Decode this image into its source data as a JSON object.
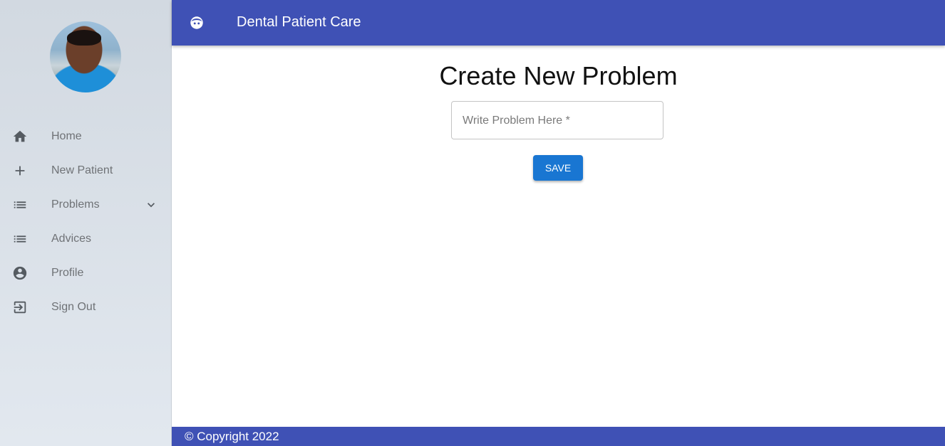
{
  "app": {
    "title": "Dental Patient Care",
    "logo_icon": "tooth-face-icon"
  },
  "sidebar": {
    "avatar_icon": "user-photo",
    "items": [
      {
        "label": "Home",
        "icon": "home-icon"
      },
      {
        "label": "New Patient",
        "icon": "plus-icon"
      },
      {
        "label": "Problems",
        "icon": "list-icon",
        "expandable": true
      },
      {
        "label": "Advices",
        "icon": "list-icon"
      },
      {
        "label": "Profile",
        "icon": "account-circle-icon"
      },
      {
        "label": "Sign Out",
        "icon": "exit-icon"
      }
    ]
  },
  "main": {
    "title": "Create New Problem",
    "problem_input": {
      "placeholder": "Write Problem Here *",
      "value": ""
    },
    "save_label": "SAVE"
  },
  "footer": {
    "copyright": "© Copyright 2022"
  },
  "colors": {
    "primary": "#3f51b5",
    "button": "#1976d2",
    "nav_text": "#6f7276"
  }
}
